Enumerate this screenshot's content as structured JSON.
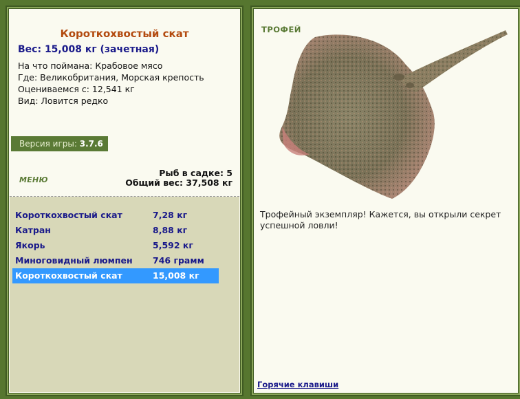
{
  "fish": {
    "title": "Короткохвостый скат",
    "weight_line": "Вес: 15,008 кг (зачетная)",
    "bait_line": "На что поймана: Крабовое мясо",
    "location_line": "Где: Великобритания, Морская крепость",
    "estimated_line": "Оцениваемся с: 12,541 кг",
    "kind_line": "Вид: Ловится редко"
  },
  "version": {
    "label": "Версия игры: ",
    "value": "3.7.6"
  },
  "menu_label": "МЕНЮ",
  "cage": {
    "count_line": "Рыб в садке: 5",
    "total_line": "Общий вес: 37,508 кг"
  },
  "catch_list": [
    {
      "name": "Короткохвостый скат",
      "weight": "7,28 кг"
    },
    {
      "name": "Катран",
      "weight": "8,88 кг"
    },
    {
      "name": "Якорь",
      "weight": "5,592 кг"
    },
    {
      "name": "Миноговидный люмпен",
      "weight": "746 грамм"
    },
    {
      "name": "Короткохвостый скат",
      "weight": "15,008 кг"
    }
  ],
  "trophy": {
    "label": "ТРОФЕЙ",
    "text": "Трофейный экземпляр! Кажется, вы открыли секрет успешной ловли!"
  },
  "hotkeys_label": "Горячие клавиши",
  "colors": {
    "frame_green": "#5a7a35",
    "title_orange": "#b34a0f",
    "link_blue": "#1a1a8a",
    "selected_blue": "#3399ff",
    "list_bg": "#d8d8b8"
  }
}
